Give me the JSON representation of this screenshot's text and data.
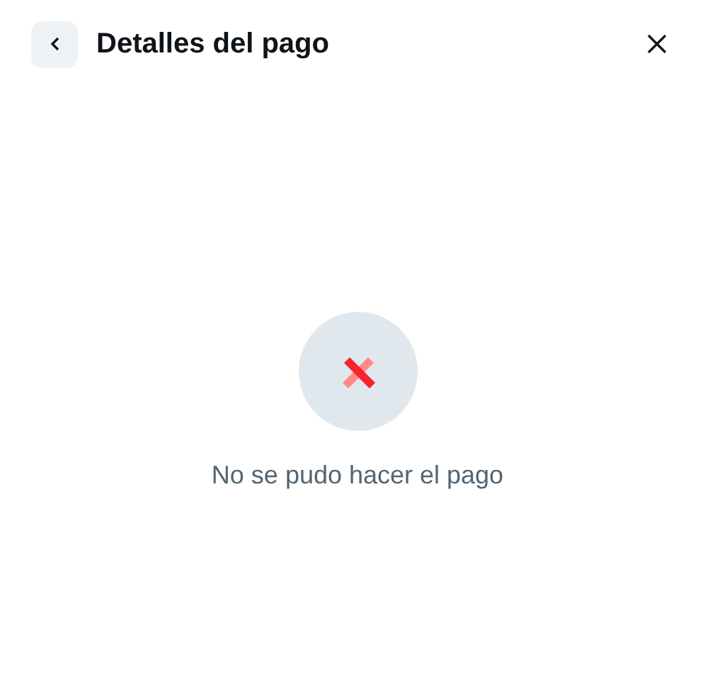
{
  "header": {
    "title": "Detalles del pago"
  },
  "status": {
    "kind": "error",
    "message": "No se pudo hacer el pago"
  }
}
